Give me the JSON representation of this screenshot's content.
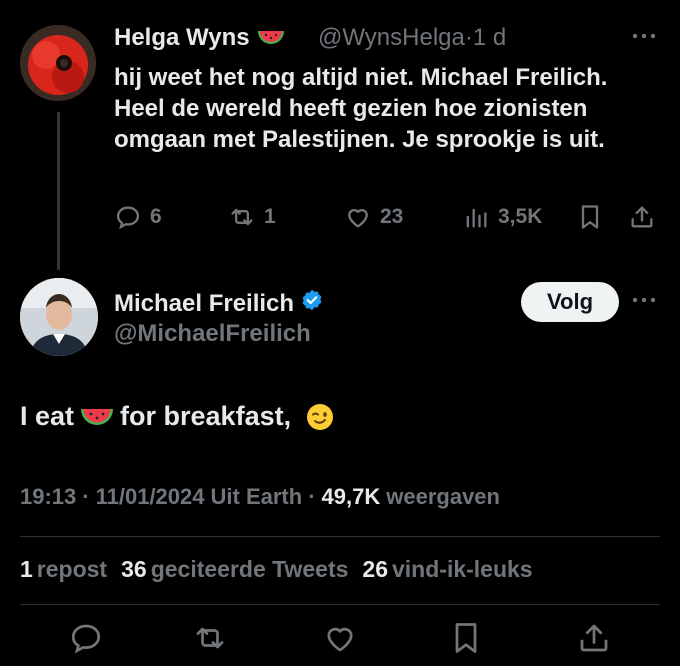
{
  "reply": {
    "display_name": "Helga Wyns",
    "handle": "@WynsHelga",
    "separator": "·",
    "age": "1 d",
    "text": "hij weet het nog altijd niet. Michael Freilich. Heel de wereld heeft gezien hoe zionisten omgaan met Palestijnen. Je sprookje is uit.",
    "actions": {
      "replies": "6",
      "reposts": "1",
      "likes": "23",
      "views": "3,5K"
    }
  },
  "tweet": {
    "display_name": "Michael Freilich",
    "handle": "@MichaelFreilich",
    "follow_label": "Volg",
    "text_before": "I eat",
    "text_after": "for breakfast,",
    "time": "19:13",
    "date": "11/01/2024",
    "location": "Uit Earth",
    "dot": "·",
    "views_count": "49,7K",
    "views_label": "weergaven",
    "stats": {
      "reposts_count": "1",
      "reposts_label": "repost",
      "quotes_count": "36",
      "quotes_label": "geciteerde Tweets",
      "likes_count": "26",
      "likes_label": "vind-ik-leuks"
    }
  },
  "colors": {
    "background": "#000000",
    "text": "#e7e9ea",
    "muted": "#71767b",
    "verified": "#1d9bf0",
    "divider": "#2f3336"
  }
}
